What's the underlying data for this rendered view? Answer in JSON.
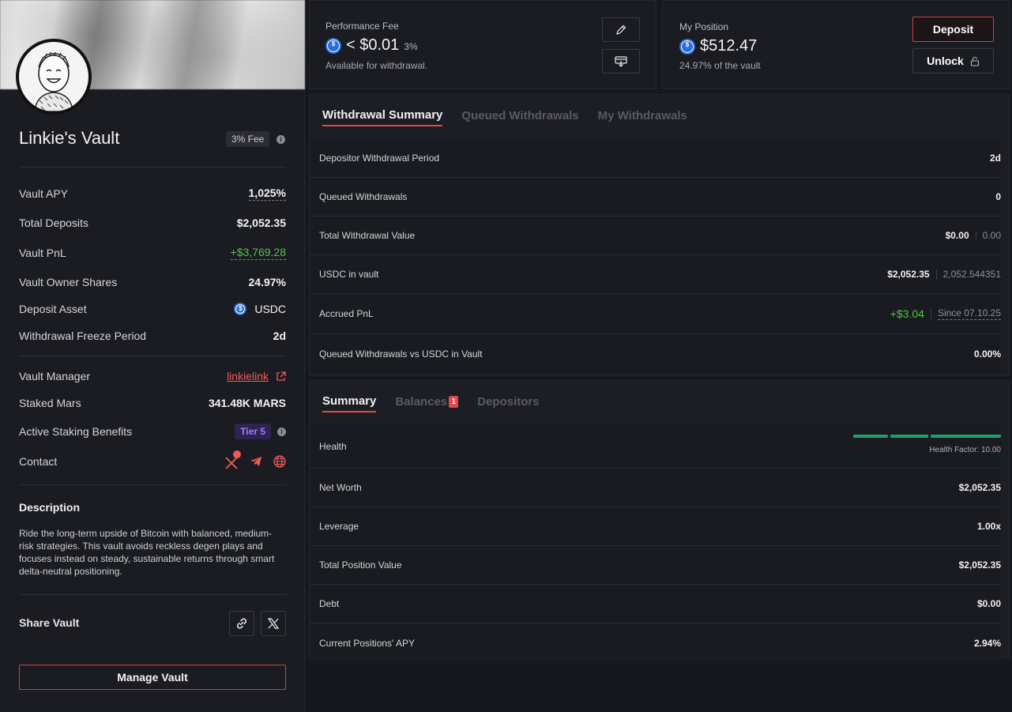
{
  "vault": {
    "title": "Linkie's Vault",
    "fee_badge": "3% Fee",
    "stats": [
      {
        "label": "Vault APY",
        "value": "1,025%"
      },
      {
        "label": "Total Deposits",
        "value": "$2,052.35"
      },
      {
        "label": "Vault PnL",
        "value": "+$3,769.28"
      },
      {
        "label": "Vault Owner Shares",
        "value": "24.97%"
      },
      {
        "label": "Deposit Asset",
        "value": "USDC"
      },
      {
        "label": "Withdrawal Freeze Period",
        "value": "2d"
      }
    ],
    "manager": {
      "label": "Vault Manager",
      "value": "linkielink"
    },
    "staked": {
      "label": "Staked Mars",
      "value": "341.48K MARS"
    },
    "benefits": {
      "label": "Active Staking Benefits",
      "value": "Tier 5"
    },
    "contact": {
      "label": "Contact"
    },
    "description_title": "Description",
    "description": "Ride the long-term upside of Bitcoin with balanced, medium-risk strategies. This vault avoids reckless degen plays and focuses instead on steady, sustainable returns through smart delta-neutral positioning.",
    "share_label": "Share Vault",
    "manage_button": "Manage Vault"
  },
  "performance_fee": {
    "label": "Performance Fee",
    "value": "< $0.01",
    "percent": "3%",
    "sub": "Available for withdrawal."
  },
  "position": {
    "label": "My Position",
    "value": "$512.47",
    "sub": "24.97% of the vault",
    "deposit_button": "Deposit",
    "unlock_button": "Unlock"
  },
  "withdrawal_tabs": [
    "Withdrawal Summary",
    "Queued Withdrawals",
    "My Withdrawals"
  ],
  "withdrawal_rows": [
    {
      "label": "Depositor Withdrawal Period",
      "value": "2d"
    },
    {
      "label": "Queued Withdrawals",
      "value": "0"
    },
    {
      "label": "Total Withdrawal Value",
      "value": "$0.00",
      "secondary": "0.00"
    },
    {
      "label": "USDC in vault",
      "value": "$2,052.35",
      "secondary": "2,052.544351"
    },
    {
      "label": "Accrued PnL",
      "value": "+$3.04",
      "secondary": "Since 07.10.25"
    },
    {
      "label": "Queued Withdrawals vs USDC in Vault",
      "value": "0.00%"
    }
  ],
  "summary_tabs": [
    "Summary",
    "Balances",
    "Depositors"
  ],
  "balances_count": "1",
  "summary_rows": [
    {
      "label": "Health",
      "health_factor": "Health Factor: 10.00"
    },
    {
      "label": "Net Worth",
      "value": "$2,052.35"
    },
    {
      "label": "Leverage",
      "value": "1.00x"
    },
    {
      "label": "Total Position Value",
      "value": "$2,052.35"
    },
    {
      "label": "Debt",
      "value": "$0.00"
    },
    {
      "label": "Current Positions' APY",
      "value": "2.94%"
    }
  ],
  "health_level": 1.0,
  "colors": {
    "accent": "#e04a4a",
    "positive": "#54c44a",
    "health": "#1f9d6a",
    "tier": "#9d7cff"
  }
}
